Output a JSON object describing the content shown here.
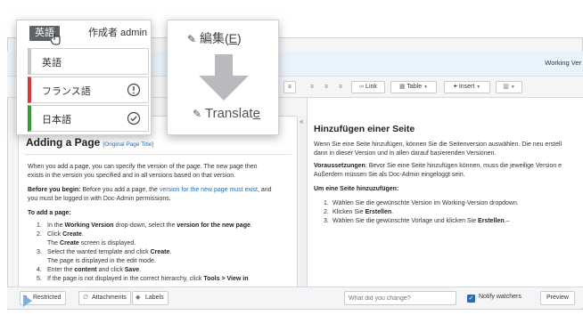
{
  "topbar": {
    "version_label": "Working Ver"
  },
  "toolbar": {
    "link": "Link",
    "table": "Table",
    "insert": "Insert"
  },
  "original": {
    "title": "Adding a Page",
    "original_title_tag": "[Original Page Title]",
    "p1": "When you add a page, you can specify the version of the page. The new page then",
    "p1b": "exists in the version you specified and in all versions based on that version.",
    "p2_bold": "Before you begin:",
    "p2_a": " Before you add a page, the ",
    "p2_link": "version for the new page must exist",
    "p2_b": ", and",
    "p2c": "you must be logged in with Doc-Admin permissions.",
    "to_add": "To add a page:",
    "steps": [
      {
        "num": "1.",
        "a": "In the ",
        "b1": "Working Version",
        "c": " drop-down, select the ",
        "b2": "version for the new page",
        "d": "."
      },
      {
        "num": "2.",
        "a": "Click ",
        "b1": "Create",
        "c": ".",
        "b2": "",
        "d": ""
      },
      {
        "num": "",
        "a": "The ",
        "b1": "Create",
        "c": " screen is displayed.",
        "b2": "",
        "d": ""
      },
      {
        "num": "3.",
        "a": "Select the wanted template and click ",
        "b1": "Create",
        "c": ".",
        "b2": "",
        "d": ""
      },
      {
        "num": "",
        "a": "The page is displayed in the edit mode.",
        "b1": "",
        "c": "",
        "b2": "",
        "d": ""
      },
      {
        "num": "4.",
        "a": "Enter the ",
        "b1": "content",
        "c": " and click ",
        "b2": "Save",
        "d": "."
      },
      {
        "num": "5.",
        "a": "If the page is not displayed in the correct hierarchy, click ",
        "b1": "Tools > View in",
        "c": "",
        "b2": "",
        "d": ""
      }
    ]
  },
  "translation": {
    "title": "Hinzufügen einer Seite",
    "p1": "Wenn Sie eine Seite hinzufügen, können Sie die Seitenversion auswählen. Die neu erstell",
    "p1b": "dann in dieser Version und in allen darauf basierenden Versionen.",
    "p2_bold": "Voraussetzungen",
    "p2": ": Bevor Sie eine Seite hinzufügen können, muss die jeweilige Version e",
    "p2b": "Außerdem müssen Sie als Doc-Admin eingeloggt sein.",
    "steps_head": "Um eine Seite hinzuzufügen:",
    "steps": [
      {
        "num": "1.",
        "a": "Wählen Sie die gewünschte Version im Working-Version dropdown.",
        "b": "",
        "c": ""
      },
      {
        "num": "2.",
        "a": "Klicken Sie ",
        "b": "Erstellen",
        "c": "."
      },
      {
        "num": "3.",
        "a": "Wählen Sie die gewünschte Vorlage und klicken Sie ",
        "b": "Erstellen",
        "c": ".–"
      }
    ]
  },
  "bottom": {
    "restricted": "Restricted",
    "attachments": "Attachments",
    "labels": "Labels",
    "change_placeholder": "What did you change?",
    "notify": "Notify watchers",
    "preview": "Preview"
  },
  "language_menu": {
    "selected": "英語",
    "author_label": "作成者 admin",
    "options": [
      {
        "label": "英語",
        "color": "#c4c6c8",
        "icon": ""
      },
      {
        "label": "フランス語",
        "color": "#d33b3b",
        "icon": "exclamation-circle-icon"
      },
      {
        "label": "日本語",
        "color": "#3a9a3a",
        "icon": "check-circle-icon"
      }
    ]
  },
  "edit_popup": {
    "edit_main": "編集(",
    "edit_key": "E",
    "edit_close": ")",
    "translate_main": "Translat",
    "translate_key": "e"
  }
}
